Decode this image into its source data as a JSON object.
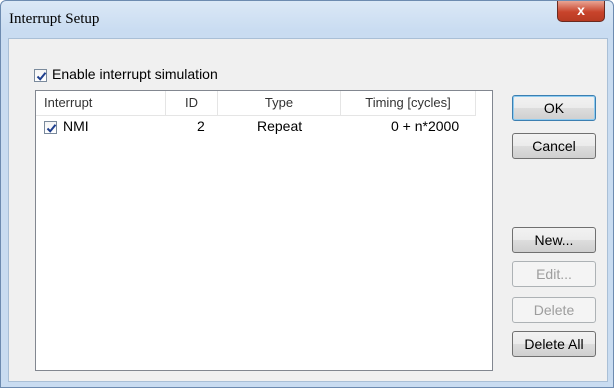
{
  "window": {
    "title": "Interrupt Setup",
    "close_glyph": "x"
  },
  "enable_checkbox": {
    "label": "Enable interrupt simulation",
    "checked": true
  },
  "table": {
    "columns": [
      "Interrupt",
      "ID",
      "Type",
      "Timing [cycles]"
    ],
    "rows": [
      {
        "checked": true,
        "interrupt": "NMI",
        "id": "2",
        "type": "Repeat",
        "timing": "0 + n*2000"
      }
    ]
  },
  "buttons": {
    "ok": "OK",
    "cancel": "Cancel",
    "new": "New...",
    "edit": "Edit...",
    "delete": "Delete",
    "delete_all": "Delete All"
  },
  "colors": {
    "accent": "#3c7fb1",
    "close": "#c8442c"
  }
}
